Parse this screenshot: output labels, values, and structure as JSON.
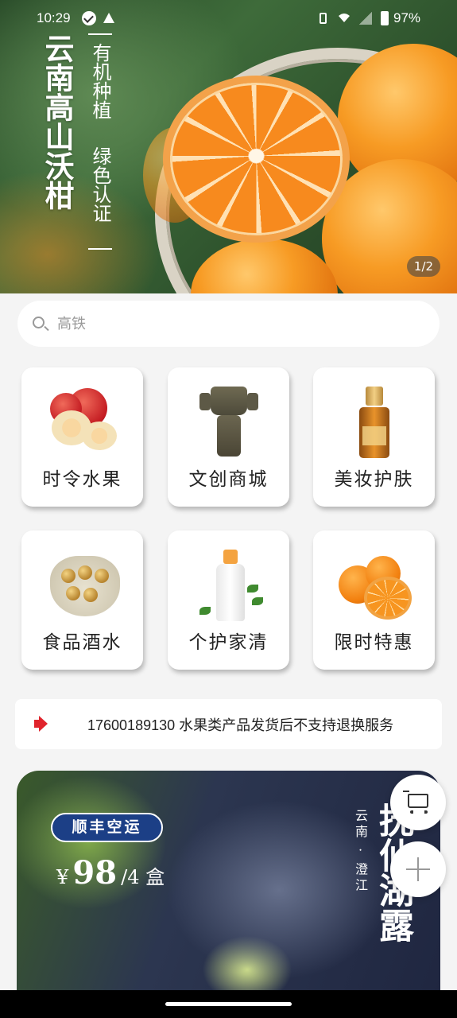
{
  "status_bar": {
    "time": "10:29",
    "battery": "97%",
    "icons": [
      "check-circle-icon",
      "warning-icon",
      "vibrate-icon",
      "wifi-icon",
      "signal-icon",
      "battery-icon"
    ]
  },
  "banner": {
    "title": "云南高山沃柑",
    "subtitle_line1": "有机种植",
    "subtitle_line2": "绿色认证",
    "pager": "1/2"
  },
  "search": {
    "placeholder": "高铁",
    "icon": "search-icon"
  },
  "categories": [
    {
      "label": "时令水果",
      "icon": "apple-image"
    },
    {
      "label": "文创商城",
      "icon": "bronze-figure-image"
    },
    {
      "label": "美妆护肤",
      "icon": "serum-bottle-image"
    },
    {
      "label": "食品酒水",
      "icon": "chocolate-box-image"
    },
    {
      "label": "个护家清",
      "icon": "lotion-bottle-image"
    },
    {
      "label": "限时特惠",
      "icon": "orange-image"
    }
  ],
  "notice": {
    "icon": "speaker-icon",
    "text": "17600189130 水果类产品发货后不支持退换服务"
  },
  "promo": {
    "badge": "顺丰空运",
    "price_symbol": "¥",
    "price": "98",
    "unit": "/4 盒",
    "origin": "云南 · 澄江",
    "name": "抚仙湖露"
  },
  "floating": {
    "cart_icon": "cart-icon",
    "add_icon": "plus-icon"
  },
  "colors": {
    "badge_bg": "#1c3f86",
    "notice_icon": "#e0242c",
    "page_bg": "#f4f4f4"
  }
}
